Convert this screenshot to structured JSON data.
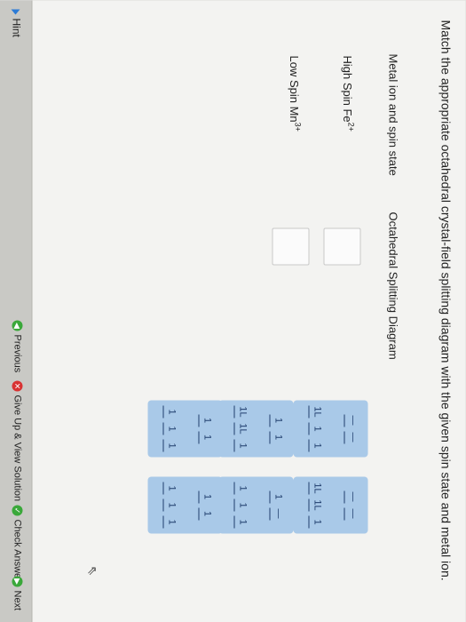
{
  "question": {
    "instruction": "Match the appropriate octahedral crystal-field splitting diagram with the given spin state and metal ion."
  },
  "table": {
    "headers": [
      "Metal ion and spin state",
      "Octahedral Splitting Diagram"
    ]
  },
  "rows": [
    {
      "label": "High Spin Fe",
      "charge": "2+"
    },
    {
      "label": "Low Spin Mn",
      "charge": "3+"
    }
  ],
  "tiles": [
    {
      "eg": [
        "—",
        "—"
      ],
      "t2g": [
        "1L",
        "1",
        "1"
      ]
    },
    {
      "eg": [
        "1",
        "1"
      ],
      "t2g": [
        "1L",
        "1L",
        "1"
      ]
    },
    {
      "eg": [
        "1",
        "1"
      ],
      "t2g": [
        "1",
        "1",
        "1"
      ]
    },
    {
      "eg": [
        "—",
        "—"
      ],
      "t2g": [
        "1L",
        "1L",
        "1"
      ]
    },
    {
      "eg": [
        "1",
        "—"
      ],
      "t2g": [
        "1",
        "1",
        "1"
      ]
    },
    {
      "eg": [
        "1",
        "1"
      ],
      "t2g": [
        "1",
        "1",
        "1"
      ]
    }
  ],
  "footer": {
    "hint": "Hint",
    "previous": "Previous",
    "give_up": "Give Up & View Solution",
    "check": "Check Answer",
    "next": "Next"
  },
  "colors": {
    "tile_blue": "#a9c9e8",
    "accent_green": "#3aa83a",
    "accent_red": "#d83333"
  }
}
